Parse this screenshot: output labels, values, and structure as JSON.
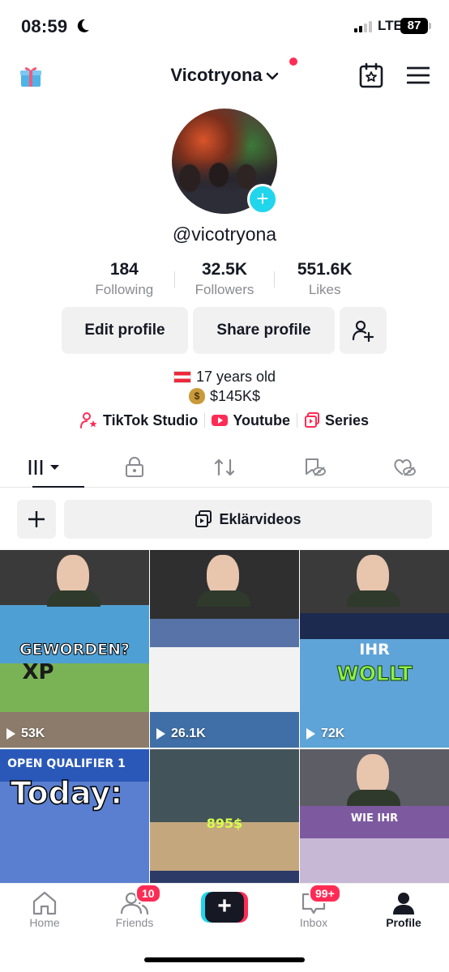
{
  "status_bar": {
    "time": "08:59",
    "network": "LTE",
    "battery": "87"
  },
  "header": {
    "username": "Vicotryona"
  },
  "profile": {
    "handle": "@vicotryona",
    "stats": [
      {
        "value": "184",
        "label": "Following"
      },
      {
        "value": "32.5K",
        "label": "Followers"
      },
      {
        "value": "551.6K",
        "label": "Likes"
      }
    ],
    "buttons": {
      "edit": "Edit profile",
      "share": "Share profile"
    },
    "bio": {
      "age_line": "17 years old",
      "money_line": "$145K$"
    },
    "links": [
      {
        "label": "TikTok Studio",
        "icon": "person-star-icon"
      },
      {
        "label": "Youtube",
        "icon": "youtube-icon"
      },
      {
        "label": "Series",
        "icon": "series-icon"
      }
    ]
  },
  "tabs": [
    {
      "name": "videos-grid",
      "icon": "grid-icon",
      "active": true
    },
    {
      "name": "private",
      "icon": "lock-icon",
      "active": false
    },
    {
      "name": "reposts",
      "icon": "repost-icon",
      "active": false
    },
    {
      "name": "favorites",
      "icon": "hidden-bookmark-icon",
      "active": false
    },
    {
      "name": "liked",
      "icon": "hidden-heart-icon",
      "active": false
    }
  ],
  "collections": {
    "explain_label": "Eklärvideos"
  },
  "videos": [
    {
      "overlay": "GEWORDEN?",
      "sub": "XP",
      "views": "53K"
    },
    {
      "overlay": "",
      "sub": "",
      "views": "26.1K"
    },
    {
      "overlay": "IHR",
      "sub": "WOLLT",
      "views": "72K"
    },
    {
      "overlay": "Today:",
      "sub": "OPEN QUALIFIER 1",
      "views": ""
    },
    {
      "overlay": "895$",
      "sub": "",
      "views": ""
    },
    {
      "overlay": "WIE IHR",
      "sub": "",
      "views": ""
    }
  ],
  "bottom_nav": {
    "home": "Home",
    "friends": "Friends",
    "friends_badge": "10",
    "inbox": "Inbox",
    "inbox_badge": "99+",
    "profile": "Profile"
  },
  "colors": {
    "accent": "#fe2c55",
    "cyan": "#20d5ec",
    "text": "#161823",
    "muted": "#8a8b91"
  }
}
